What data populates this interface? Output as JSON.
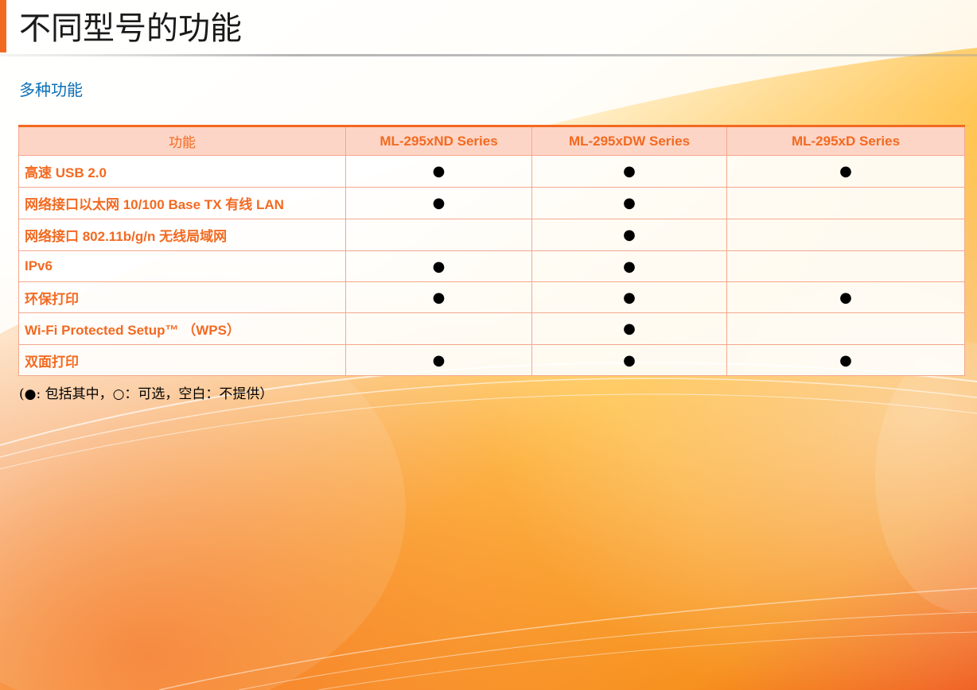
{
  "page": {
    "title": "不同型号的功能",
    "section_heading": "多种功能",
    "accent_color": "#f26a21",
    "heading_color": "#0b6fb6"
  },
  "table": {
    "headers": [
      "功能",
      "ML-295xND Series",
      "ML-295xDW Series",
      "ML-295xD Series"
    ],
    "rows": [
      {
        "feature": "高速 USB 2.0",
        "marks": [
          "●",
          "●",
          "●"
        ]
      },
      {
        "feature": "网络接口以太网 10/100 Base TX 有线 LAN",
        "marks": [
          "●",
          "●",
          ""
        ]
      },
      {
        "feature": "网络接口 802.11b/g/n 无线局域网",
        "marks": [
          "",
          "●",
          ""
        ]
      },
      {
        "feature": "IPv6",
        "marks": [
          "●",
          "●",
          ""
        ]
      },
      {
        "feature": "环保打印",
        "marks": [
          "●",
          "●",
          "●"
        ]
      },
      {
        "feature": "Wi-Fi Protected Setup™ （WPS）",
        "marks": [
          "",
          "●",
          ""
        ]
      },
      {
        "feature": "双面打印",
        "marks": [
          "●",
          "●",
          "●"
        ]
      }
    ]
  },
  "footnote": "(●: 包括其中，○：可选，空白：不提供）"
}
